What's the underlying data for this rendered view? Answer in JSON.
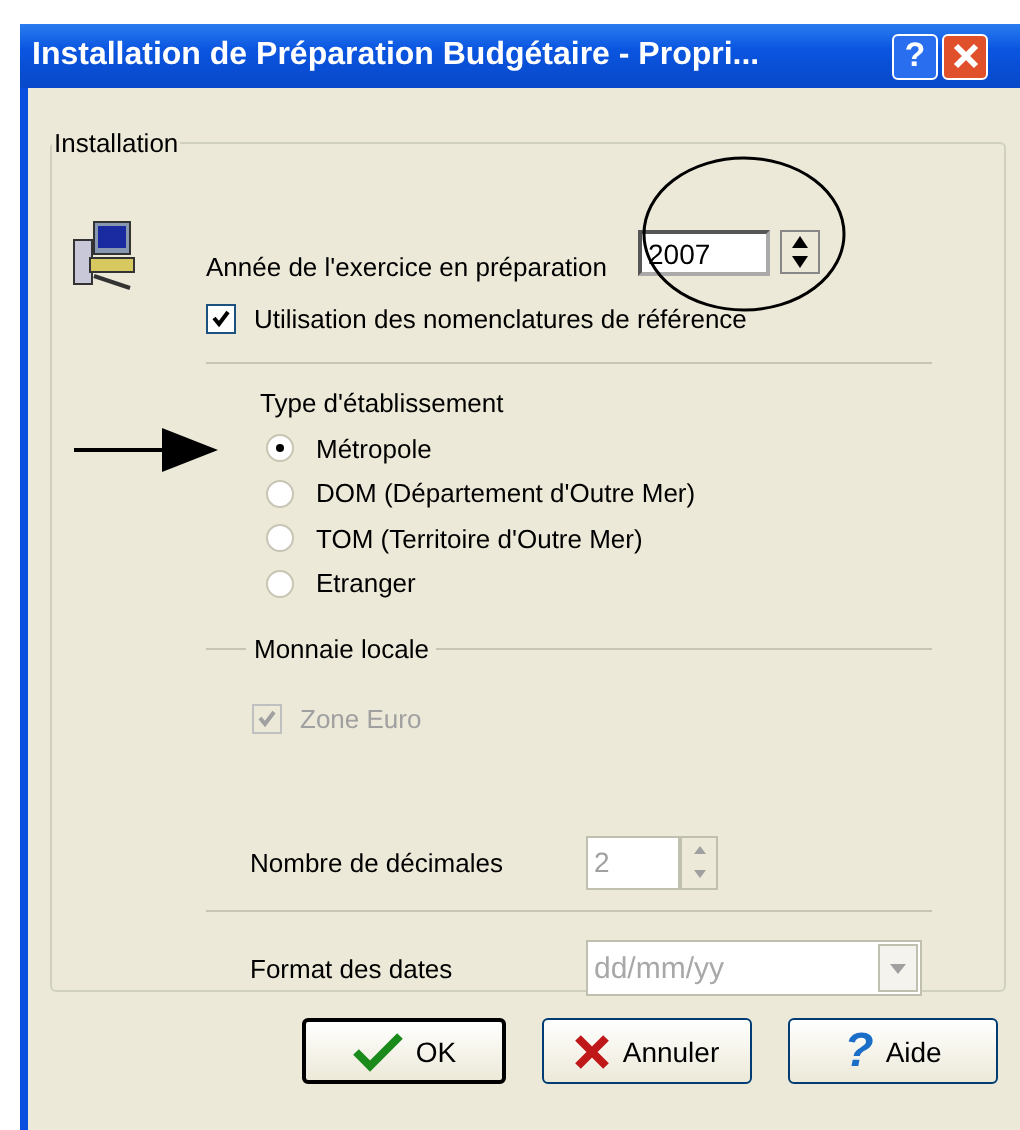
{
  "window": {
    "title": "Installation de Préparation Budgétaire - Propri...",
    "help": "?"
  },
  "group": {
    "label": "Installation"
  },
  "year": {
    "label": "Année de l'exercice en préparation",
    "value": "2007"
  },
  "nomenclature": {
    "label": "Utilisation des nomenclatures de référence",
    "checked": true
  },
  "establishment": {
    "label": "Type d'établissement",
    "options": [
      {
        "label": "Métropole",
        "selected": true
      },
      {
        "label": "DOM (Département d'Outre Mer)",
        "selected": false
      },
      {
        "label": "TOM (Territoire d'Outre Mer)",
        "selected": false
      },
      {
        "label": "Etranger",
        "selected": false
      }
    ]
  },
  "currency": {
    "label": "Monnaie locale",
    "euro": {
      "label": "Zone Euro",
      "checked": true,
      "disabled": true
    }
  },
  "decimals": {
    "label": "Nombre de décimales",
    "value": "2",
    "disabled": true
  },
  "date_format": {
    "label": "Format des dates",
    "value": "dd/mm/yy",
    "disabled": true
  },
  "buttons": [
    {
      "kind": "ok",
      "label": "OK"
    },
    {
      "kind": "cancel",
      "label": "Annuler"
    },
    {
      "kind": "help",
      "label": "Aide",
      "icon": "?"
    }
  ]
}
